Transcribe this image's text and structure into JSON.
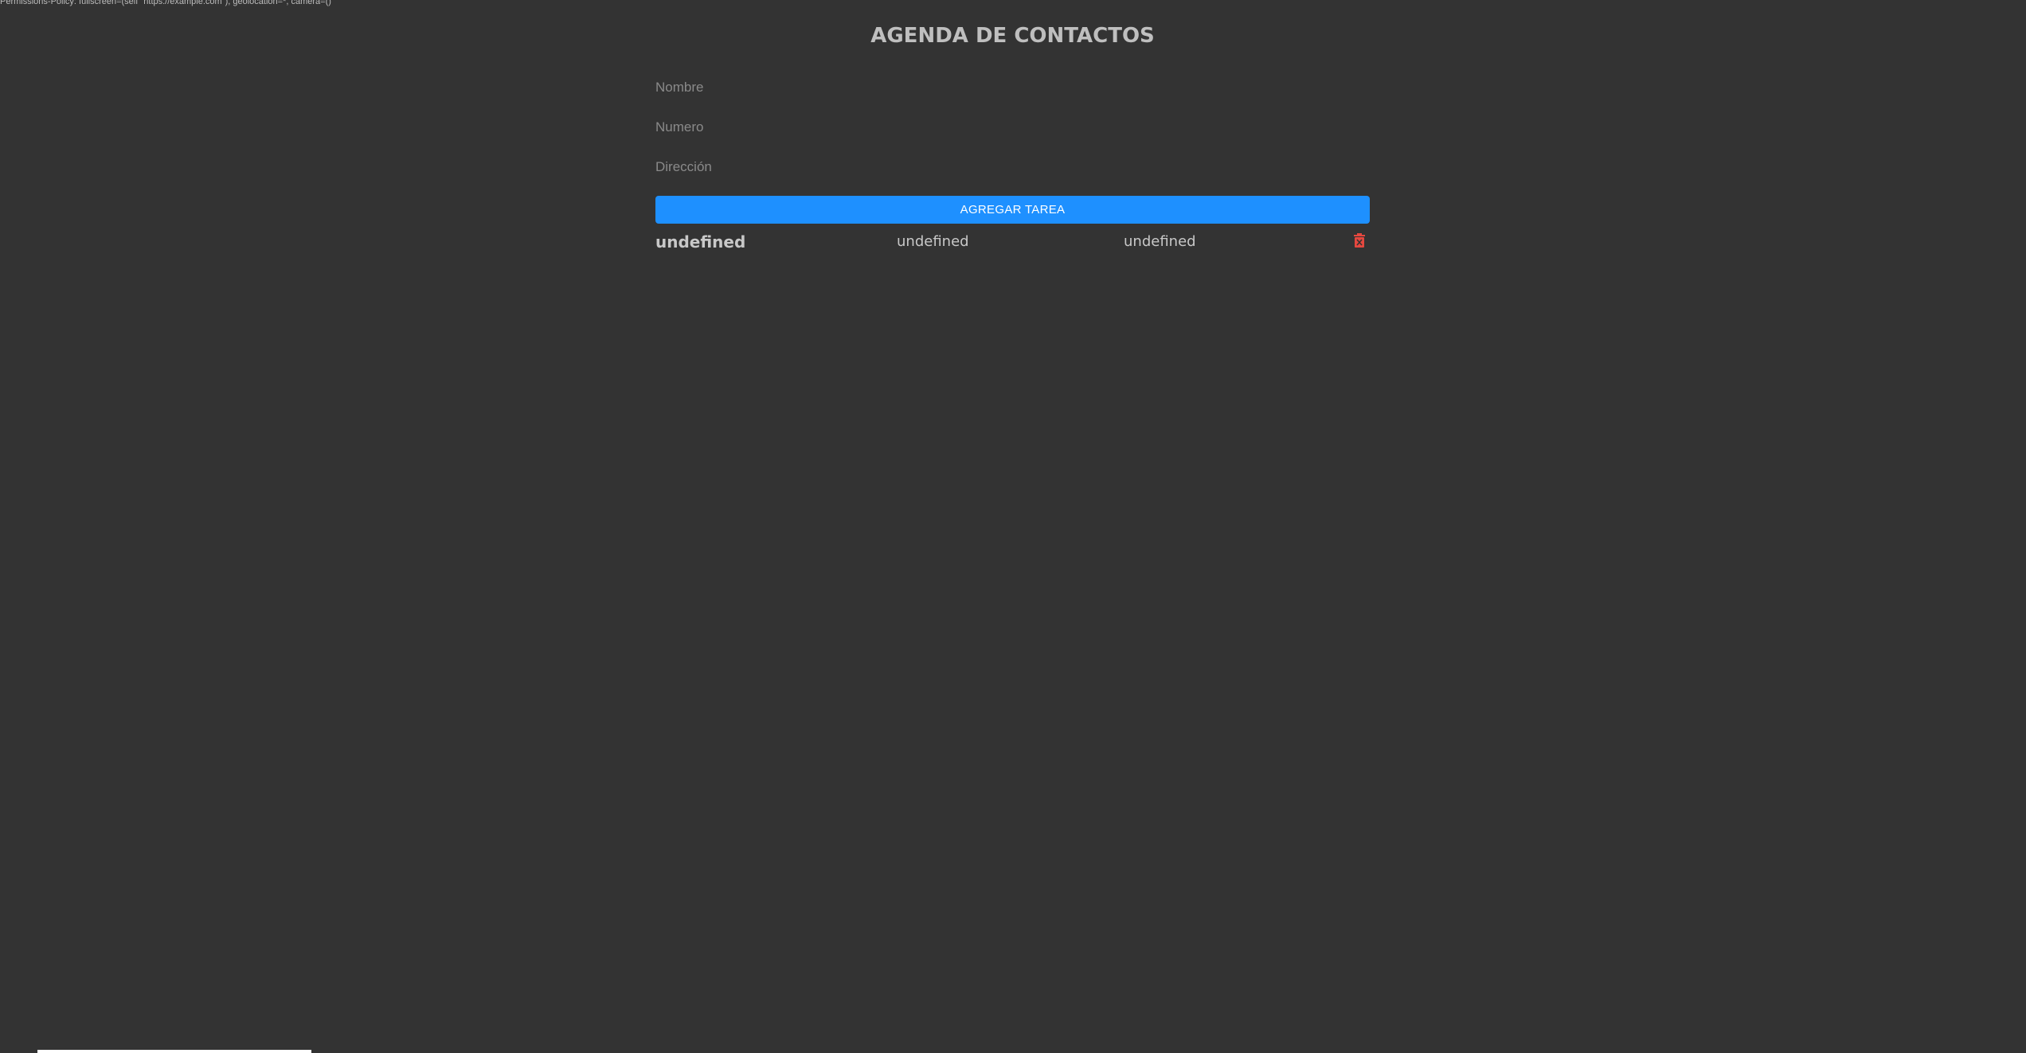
{
  "console_message": "Permissions-Policy: fullscreen=(self \"https://example.com\"), geolocation=*, camera=()",
  "title": "AGENDA DE CONTACTOS",
  "form": {
    "name_placeholder": "Nombre",
    "number_placeholder": "Numero",
    "address_placeholder": "Dirección",
    "submit_label": "AGREGAR TAREA"
  },
  "contacts": [
    {
      "name": "undefined",
      "number": "undefined",
      "address": "undefined",
      "delete_icon": "trash-icon"
    }
  ],
  "colors": {
    "background": "#333333",
    "accent": "#1e90ff",
    "danger": "#e5483f"
  }
}
